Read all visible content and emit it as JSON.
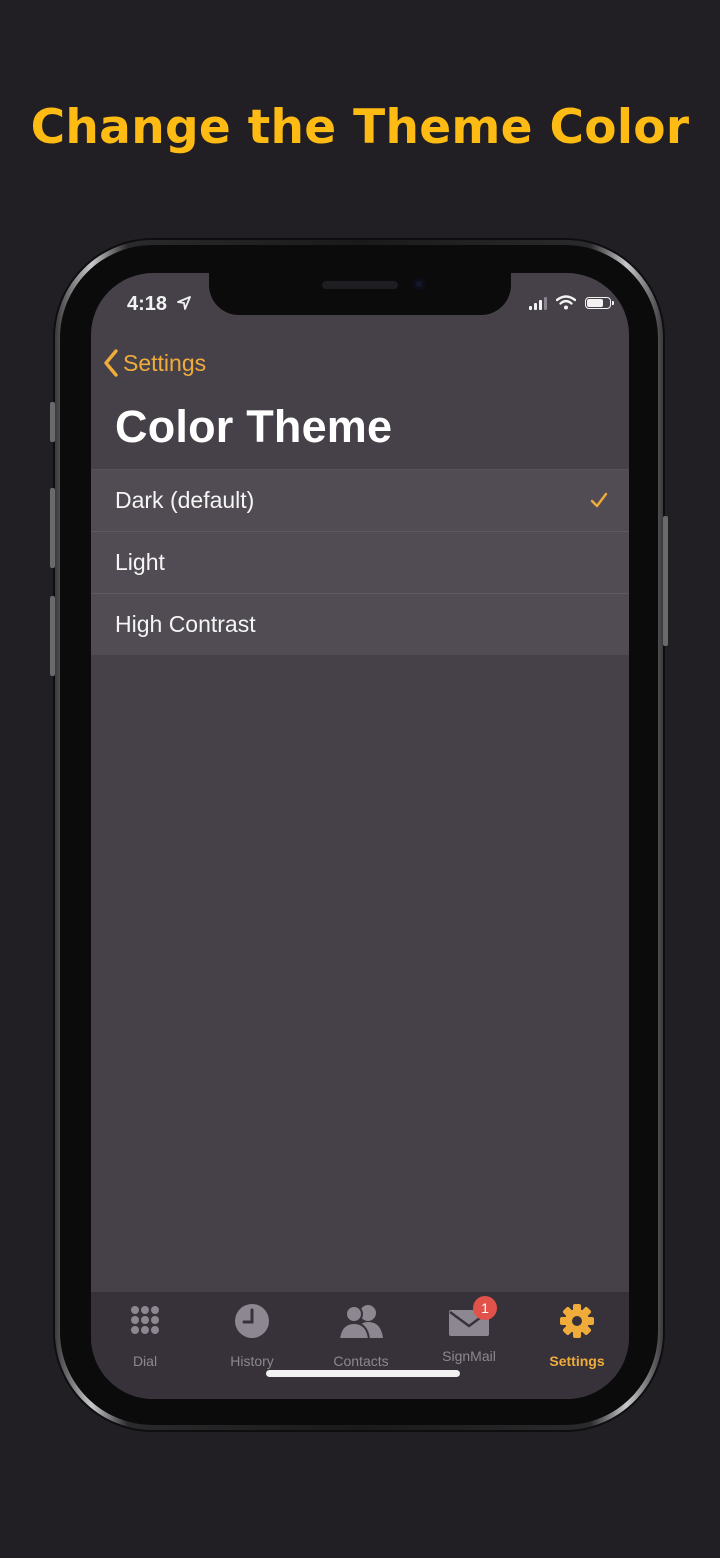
{
  "headline": "Change the Theme Color",
  "status_bar": {
    "time": "4:18"
  },
  "nav": {
    "back_label": "Settings",
    "title": "Color Theme"
  },
  "themes": [
    {
      "label": "Dark (default)",
      "selected": true
    },
    {
      "label": "Light",
      "selected": false
    },
    {
      "label": "High Contrast",
      "selected": false
    }
  ],
  "tab_bar": {
    "tabs": [
      {
        "label": "Dial",
        "icon": "dial-icon"
      },
      {
        "label": "History",
        "icon": "clock-icon"
      },
      {
        "label": "Contacts",
        "icon": "contacts-icon"
      },
      {
        "label": "SignMail",
        "icon": "mail-icon",
        "badge": "1"
      },
      {
        "label": "Settings",
        "icon": "gear-icon",
        "active": true
      }
    ]
  },
  "colors": {
    "background": "#221f24",
    "headline": "#fdbb14",
    "accent": "#f0ac3b",
    "screen": "#464149",
    "list": "#514b53",
    "tabbar": "#373239",
    "badge": "#e0524a"
  }
}
